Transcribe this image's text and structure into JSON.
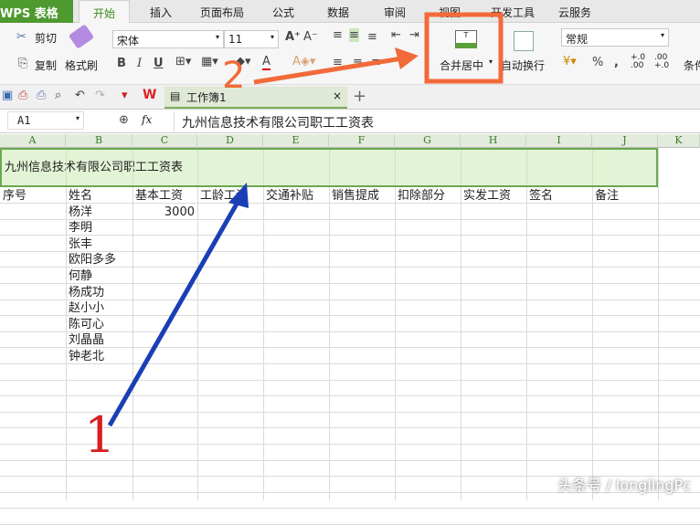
{
  "app": {
    "name": "WPS 表格"
  },
  "tabs": [
    "开始",
    "插入",
    "页面布局",
    "公式",
    "数据",
    "审阅",
    "视图",
    "开发工具",
    "云服务"
  ],
  "ribbon": {
    "cut": "剪切",
    "copy": "复制",
    "format_painter": "格式刷",
    "font": "宋体",
    "font_size": "11",
    "merge_center": "合并居中",
    "wrap_text": "自动换行",
    "number_format": "常规",
    "percent": "%",
    "conditional": "条件"
  },
  "document_tab": {
    "title": "工作簿1"
  },
  "formula_bar": {
    "cell_ref": "A1",
    "fx": "fx",
    "value": "九州信息技术有限公司职工工资表"
  },
  "columns": [
    "A",
    "B",
    "C",
    "D",
    "E",
    "F",
    "G",
    "H",
    "I",
    "J",
    "K"
  ],
  "sheet": {
    "title": "九州信息技术有限公司职工工资表",
    "headers": [
      "序号",
      "姓名",
      "基本工资",
      "工龄工资",
      "交通补贴",
      "销售提成",
      "扣除部分",
      "实发工资",
      "签名",
      "备注"
    ],
    "names": [
      "杨洋",
      "李明",
      "张丰",
      "欧阳多多",
      "何静",
      "杨成功",
      "赵小小",
      "陈可心",
      "刘晶晶",
      "钟老北"
    ],
    "first_salary": "3000"
  },
  "annotations": {
    "step1": "1",
    "step2": "2",
    "step1_color": "#1a3fb5",
    "step2_color": "#f26a3a"
  },
  "watermark": "头条号 / longlingPc",
  "colors": {
    "accent": "#4e9a2e",
    "selection": "#e3f3d5"
  }
}
